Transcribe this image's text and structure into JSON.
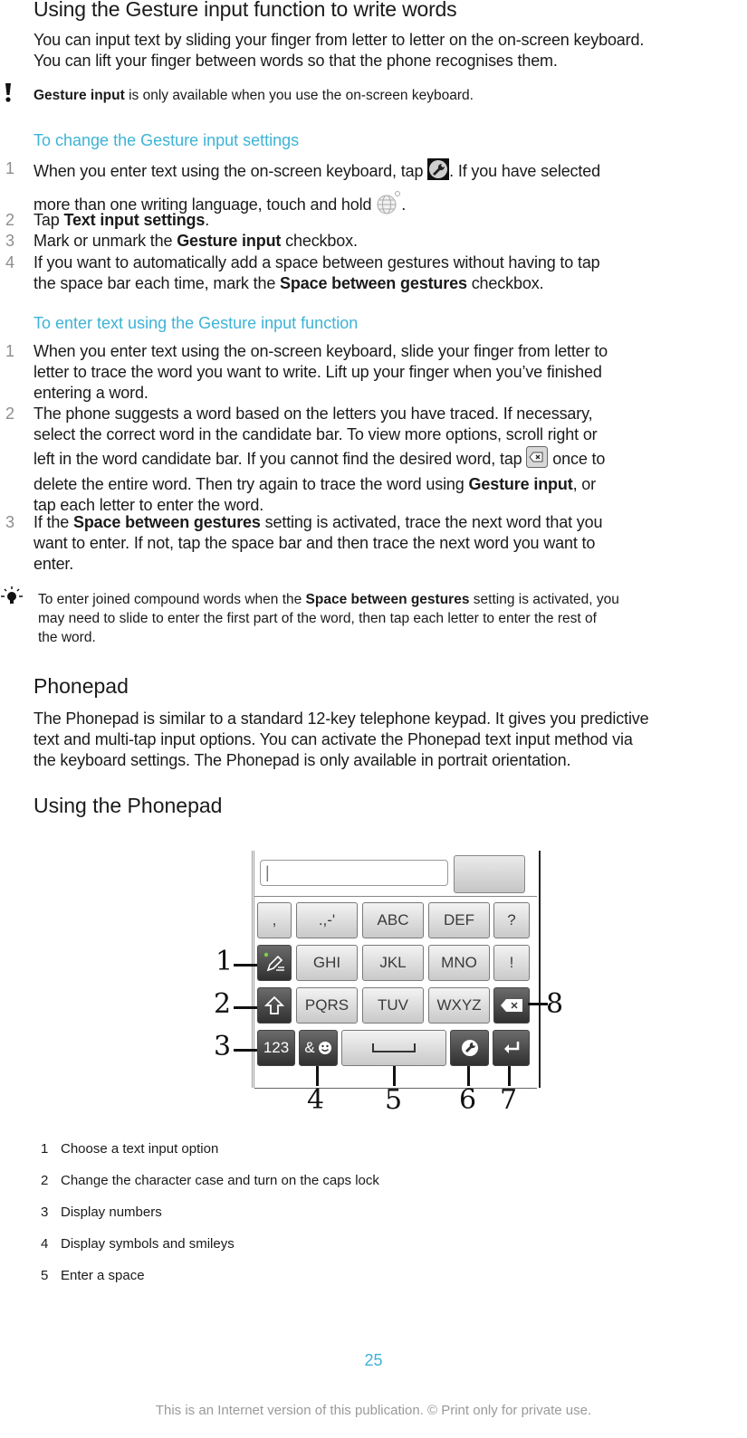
{
  "section_gesture": {
    "title": "Using the Gesture input function to write words",
    "intro_line1": "You can input text by sliding your finger from letter to letter on the on-screen keyboard.",
    "intro_line2": "You can lift your finger between words so that the phone recognises them.",
    "warning_icon": "exclamation-icon",
    "warning_bold": "Gesture input",
    "warning_rest": " is only available when you use the on-screen keyboard."
  },
  "change_settings": {
    "heading": "To change the Gesture input settings",
    "steps": [
      {
        "num": "1",
        "l1a": "When you enter text using the on-screen keyboard, tap ",
        "l1b": ". If you have selected",
        "l2a": "more than one writing language, touch and hold ",
        "l2b": "."
      },
      {
        "num": "2",
        "a": "Tap ",
        "bold": "Text input settings",
        "b": "."
      },
      {
        "num": "3",
        "a": "Mark or unmark the ",
        "bold": "Gesture input",
        "b": " checkbox."
      },
      {
        "num": "4",
        "l1": "If you want to automatically add a space between gestures without having to tap",
        "l2a": "the space bar each time, mark the ",
        "bold": "Space between gestures",
        "l2b": " checkbox."
      }
    ]
  },
  "enter_text": {
    "heading": "To enter text using the Gesture input function",
    "steps": [
      {
        "num": "1",
        "l1": "When you enter text using the on-screen keyboard, slide your finger from letter to",
        "l2": "letter to trace the word you want to write. Lift up your finger when you’ve finished",
        "l3": "entering a word."
      },
      {
        "num": "2",
        "l1": "The phone suggests a word based on the letters you have traced. If necessary,",
        "l2": "select the correct word in the candidate bar. To view more options, scroll right or",
        "l3a": "left in the word candidate bar. If you cannot find the desired word, tap ",
        "l3b": " once to",
        "l4a": "delete the entire word. Then try again to trace the word using ",
        "l4bold": "Gesture input",
        "l4b": ", or",
        "l5": "tap each letter to enter the word."
      },
      {
        "num": "3",
        "l1a": "If the ",
        "l1bold": "Space between gestures",
        "l1b": " setting is activated, trace the next word that you",
        "l2": "want to enter. If not, tap the space bar and then trace the next word you want to",
        "l3": "enter."
      }
    ]
  },
  "tip": {
    "icon": "lightbulb-icon",
    "l1a": "To enter joined compound words when the ",
    "l1bold": "Space between gestures",
    "l1b": " setting is activated, you",
    "l2": "may need to slide to enter the first part of the word, then tap each letter to enter the rest of",
    "l3": "the word."
  },
  "phonepad": {
    "title": "Phonepad",
    "p1": "The Phonepad is similar to a standard 12-key telephone keypad. It gives you predictive",
    "p2": "text and multi-tap input options. You can activate the Phonepad text input method via",
    "p3": "the keyboard settings. The Phonepad is only available in portrait orientation."
  },
  "using_phonepad": {
    "title": "Using the Phonepad",
    "keyboard": {
      "text_field_value": "|",
      "row1": [
        ",",
        ".,-'",
        "ABC",
        "DEF",
        "?"
      ],
      "row2": [
        "pen-icon",
        "GHI",
        "JKL",
        "MNO",
        "!"
      ],
      "row3": [
        "shift-icon",
        "PQRS",
        "TUV",
        "WXYZ",
        "backspace-icon"
      ],
      "row4": [
        "123",
        "&",
        "space-icon",
        "wrench-icon",
        "enter-icon"
      ]
    },
    "callouts": [
      "1",
      "2",
      "3",
      "4",
      "5",
      "6",
      "7",
      "8"
    ],
    "legend": [
      {
        "num": "1",
        "text": "Choose a text input option"
      },
      {
        "num": "2",
        "text": "Change the character case and turn on the caps lock"
      },
      {
        "num": "3",
        "text": "Display numbers"
      },
      {
        "num": "4",
        "text": "Display symbols and smileys"
      },
      {
        "num": "5",
        "text": "Enter a space"
      }
    ]
  },
  "footer": {
    "page_number": "25",
    "notice": "This is an Internet version of this publication. © Print only for private use."
  }
}
